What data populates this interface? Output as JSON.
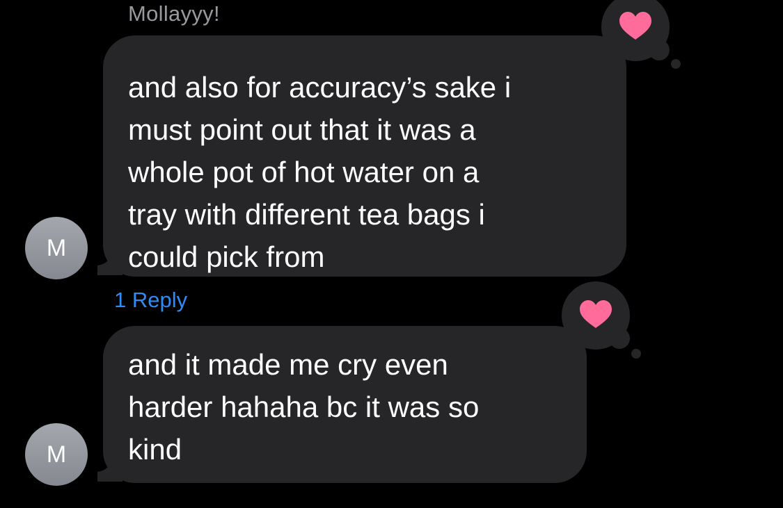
{
  "thread": {
    "sender_name": "Mollayyy!",
    "messages": [
      {
        "lines": "and also for accuracy’s sake i\nmust point out that it was a\nwhole pot of hot water on a\ntray with different tea bags i\ncould pick from",
        "avatar_initial": "M",
        "reaction": "heart-icon",
        "reply_count_label": "1 Reply"
      },
      {
        "lines": "and it made me cry even\nharder hahaha bc it was so\nkind",
        "avatar_initial": "M",
        "reaction": "heart-icon"
      }
    ]
  },
  "colors": {
    "background": "#000000",
    "bubble": "#262629",
    "sender_name": "#98989f",
    "link": "#2f8cf6",
    "heart": "#ff6b9b",
    "avatar": "#9a9ca3"
  }
}
